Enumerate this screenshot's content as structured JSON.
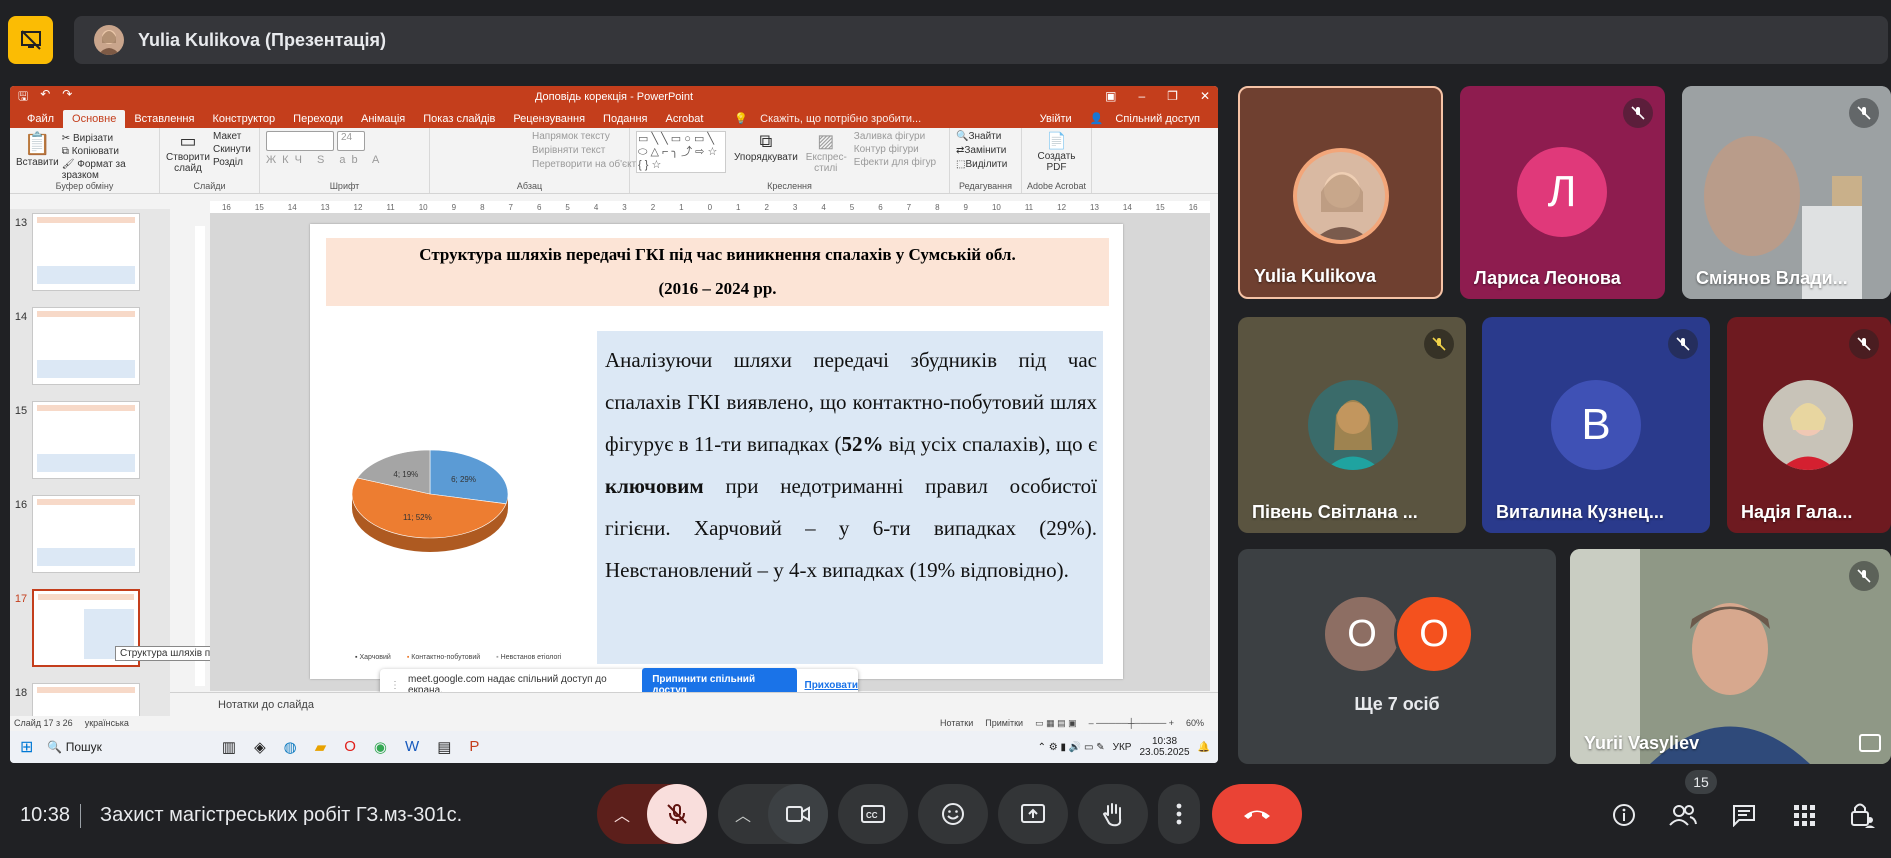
{
  "presenter": {
    "name": "Yulia Kulikova (Презентація)"
  },
  "powerpoint": {
    "window_title": "Доповідь корекція - PowerPoint",
    "tabs": [
      "Файл",
      "Основне",
      "Вставлення",
      "Конструктор",
      "Переходи",
      "Анімація",
      "Показ слайдів",
      "Рецензування",
      "Подання",
      "Acrobat"
    ],
    "search": "Скажіть, що потрібно зробити...",
    "signin": "Увійти",
    "share": "Спільний доступ",
    "ribbon": {
      "paste": "Вставити",
      "cut": "Вирізати",
      "copy": "Копіювати",
      "format_painter": "Формат за зразком",
      "clipboard": "Буфер обміну",
      "new_slide": "Створити слайд",
      "layout": "Макет",
      "reset": "Скинути",
      "section": "Розділ",
      "slides": "Слайди",
      "font_size": "24",
      "font": "Шрифт",
      "text_direction": "Напрямок тексту",
      "align_text": "Вирівняти текст",
      "convert_smartart": "Перетворити на об'єкт SmartArt",
      "paragraph": "Абзац",
      "arrange": "Упорядкувати",
      "quick_styles": "Експрес-стилі",
      "shape_fill": "Заливка фігури",
      "shape_outline": "Контур фігури",
      "shape_effects": "Ефекти для фігур",
      "drawing": "Креслення",
      "find": "Знайти",
      "replace": "Замінити",
      "select": "Виділити",
      "editing": "Редагування",
      "create_pdf": "Создать PDF",
      "adobe_acrobat": "Adobe Acrobat"
    },
    "slide_numbers": [
      "13",
      "14",
      "15",
      "16",
      "17",
      "18"
    ],
    "thumb_tooltip": "Структура шляхів передачі ГКІ ...",
    "ruler_marks": [
      "16",
      "15",
      "14",
      "13",
      "12",
      "11",
      "10",
      "9",
      "8",
      "7",
      "6",
      "5",
      "4",
      "3",
      "2",
      "1",
      "0",
      "1",
      "2",
      "3",
      "4",
      "5",
      "6",
      "7",
      "8",
      "9",
      "10",
      "11",
      "12",
      "13",
      "14",
      "15",
      "16"
    ],
    "slide": {
      "title_line1": "Структура шляхів передачі ГКІ під час виникнення спалахів у Сумській обл.",
      "title_line2": "(2016 – 2024 рр.",
      "body_a": "Аналізуючи шляхи передачі збудників під час спалахів ГКІ виявлено, що контактно-побутовий шлях фігурує в 11-ти випадках (",
      "body_bold1": "52%",
      "body_b": " від усіх спалахів), що є ",
      "body_bold2": "ключовим",
      "body_c": " при недотриманні правил особистої гігієни. Харчовий – у 6-ти випадках (29%). Невстановлений – у 4-х випадках (19% відповідно)."
    },
    "notes": "Нотатки до слайда",
    "status": {
      "slide": "Слайд 17 з 26",
      "lang": "українська",
      "notes": "Нотатки",
      "comments": "Примітки",
      "zoom": "60%"
    },
    "taskbar": {
      "search": "Пошук",
      "lang": "УКР",
      "time": "10:38",
      "date": "23.05.2025"
    },
    "share_popup": {
      "text": "meet.google.com надає спільний доступ до екрана.",
      "stop": "Припинити спільний доступ",
      "hide": "Приховати"
    }
  },
  "chart_data": {
    "type": "pie",
    "categories": [
      "Харчовий",
      "Контактно-побутовий",
      "Невстановлений"
    ],
    "values": [
      6,
      11,
      4
    ],
    "data_labels": [
      "6; 29%",
      "11; 52%",
      "4; 19%"
    ],
    "legend_labels": [
      "Харчовий",
      "Контактно-побутовий",
      "Невстанов етіологі"
    ],
    "colors": [
      "#5b9bd5",
      "#ed7d31",
      "#a5a5a5"
    ]
  },
  "participants": [
    {
      "name": "Yulia Kulikova",
      "muted": false,
      "bg": "#6f4030"
    },
    {
      "name": "Лариса Леонова",
      "letter": "Л",
      "muted": true,
      "bg": "#8e1c4f",
      "avatar": "#e0397a"
    },
    {
      "name": "Сміянов Влади...",
      "muted": true,
      "bg": "#8a8f91"
    },
    {
      "name": "Півень Світлана ...",
      "muted": true,
      "bg": "#5a5440"
    },
    {
      "name": "Виталина Кузнец...",
      "letter": "В",
      "muted": true,
      "bg": "#2a3a8c",
      "avatar": "#3f51b5"
    },
    {
      "name": "Надія Гала...",
      "muted": true,
      "bg": "#6e1a20"
    },
    {
      "name": "Ще 7 осіб",
      "letters": [
        "О",
        "О"
      ],
      "bg": "#3c4043"
    },
    {
      "name": "Yurii Vasyliev",
      "muted": true,
      "bg": "#8b9480"
    }
  ],
  "meeting": {
    "time": "10:38",
    "title": "Захист магістреських робіт ГЗ.мз-301с.",
    "participants_count": "15"
  },
  "colors": {
    "presenting": "#fbbc04",
    "end_call": "#ea4335",
    "mic_off": "#f9dedc",
    "ppt_red": "#c43e1c"
  }
}
